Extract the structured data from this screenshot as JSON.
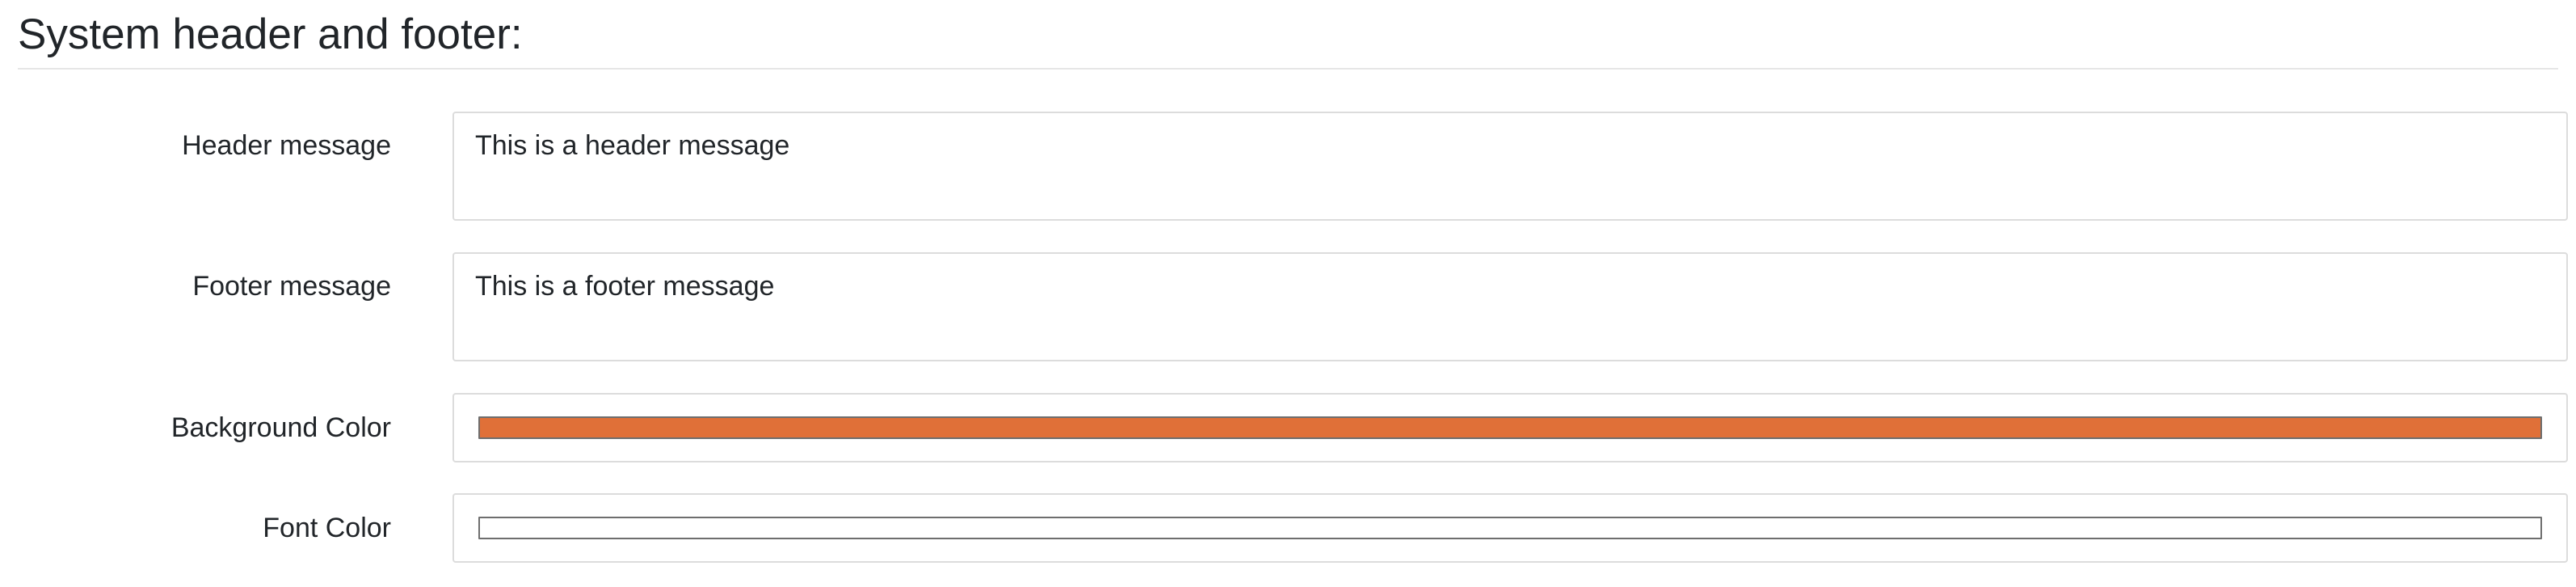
{
  "section": {
    "title": "System header and footer:"
  },
  "header_message": {
    "label": "Header message",
    "value": "This is a header message"
  },
  "footer_message": {
    "label": "Footer message",
    "value": "This is a footer message"
  },
  "background_color": {
    "label": "Background Color",
    "value": "#e07038"
  },
  "font_color": {
    "label": "Font Color",
    "value": "#ffffff"
  }
}
